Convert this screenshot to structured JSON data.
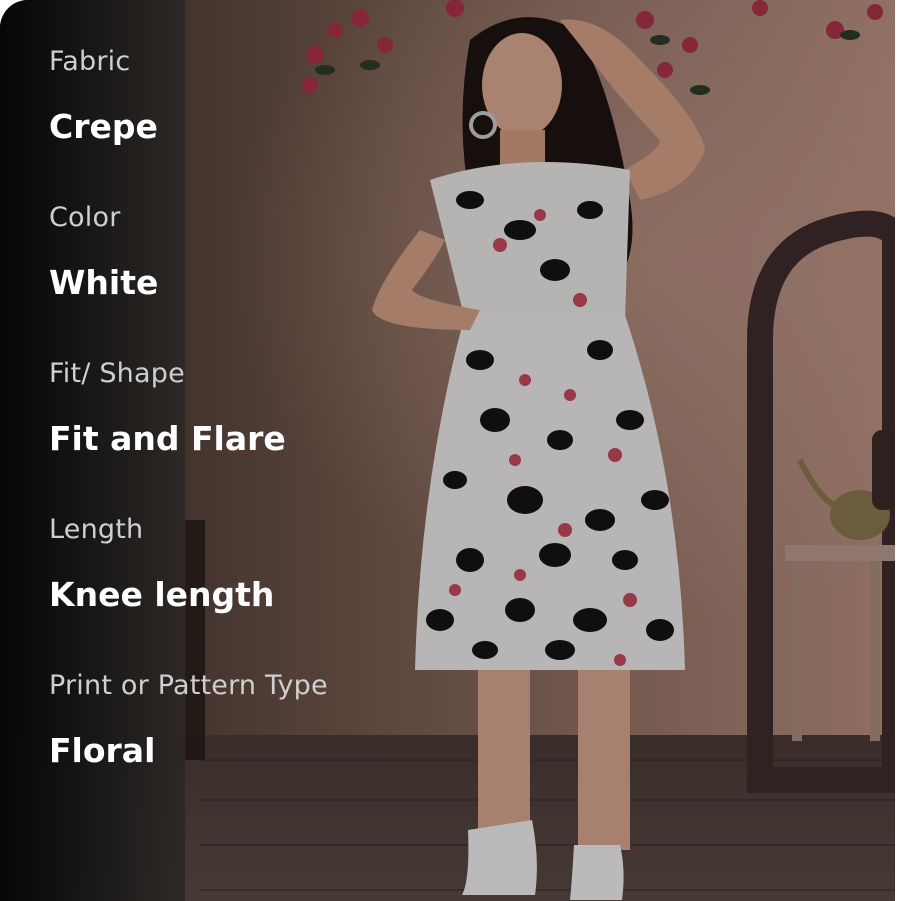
{
  "attributes": [
    {
      "label": "Fabric",
      "value": "Crepe"
    },
    {
      "label": "Color",
      "value": "White"
    },
    {
      "label": "Fit/ Shape",
      "value": "Fit and Flare"
    },
    {
      "label": "Length",
      "value": "Knee length"
    },
    {
      "label": "Print or Pattern Type",
      "value": "Floral"
    }
  ],
  "colors": {
    "panel": "#0a0a0a",
    "label": "#cfcfcf",
    "value": "#ffffff"
  }
}
